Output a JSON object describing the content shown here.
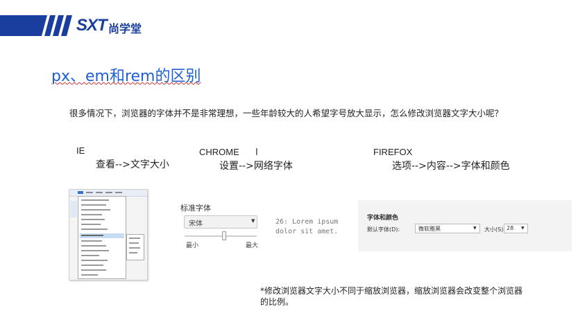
{
  "header": {
    "brand_logo_text": "SXT",
    "brand_name_cn": "尚学堂",
    "brand_color": "#1a3e9e"
  },
  "slide": {
    "title": "px、em和rem的区别",
    "paragraph": "很多情况下，浏览器的字体并不是非常理想，一些年龄较大的人希望字号放大显示，怎么修改浏览器文字大小呢？",
    "note": "*修改浏览器文字大小不同于缩放浏览器，缩放浏览器会改变整个浏览器的比例。"
  },
  "browsers": {
    "ie": {
      "name": "IE",
      "path": "查看-->文字大小"
    },
    "chrome": {
      "name": "CHROME",
      "path": "设置-->网络字体"
    },
    "firefox": {
      "name": "FIREFOX",
      "path": "选项-->内容-->字体和颜色"
    }
  },
  "chrome_settings": {
    "section_label": "标准字体",
    "font_value": "宋体",
    "slider_min": "最小",
    "slider_max": "最大",
    "slider_level": 0.55,
    "preview_text": "26: Lorem ipsum dolor sit amet."
  },
  "firefox_settings": {
    "heading": "字体和颜色",
    "default_font_label": "默认字体(D):",
    "default_font_value": "微软雅黑",
    "size_label": "大小(S):",
    "size_value": "28"
  }
}
